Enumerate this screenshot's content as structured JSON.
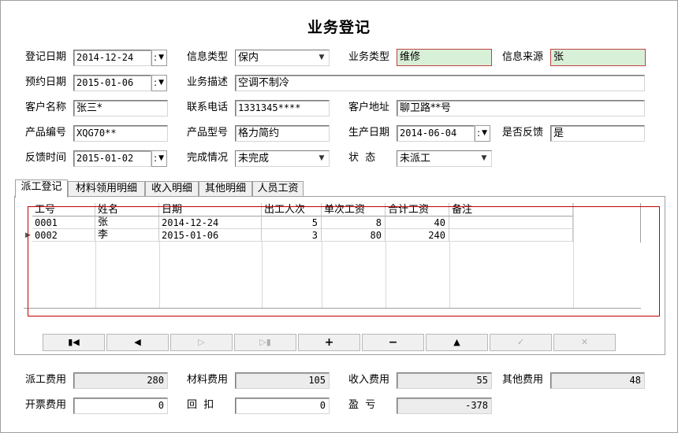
{
  "title": "业务登记",
  "form": {
    "reg_date_label": "登记日期",
    "reg_date": "2014-12-24",
    "info_type_label": "信息类型",
    "info_type": "保内",
    "biz_type_label": "业务类型",
    "biz_type": "维修",
    "info_source_label": "信息来源",
    "info_source": "张",
    "appt_date_label": "预约日期",
    "appt_date": "2015-01-06",
    "biz_desc_label": "业务描述",
    "biz_desc": "空调不制冷",
    "customer_label": "客户名称",
    "customer": "张三*",
    "phone_label": "联系电话",
    "phone": "1331345****",
    "address_label": "客户地址",
    "address": "聊卫路**号",
    "product_no_label": "产品编号",
    "product_no": "XQG70**",
    "product_model_label": "产品型号",
    "product_model": "格力简约",
    "prod_date_label": "生产日期",
    "prod_date": "2014-06-04",
    "feedback_label": "是否反馈",
    "feedback": "是",
    "feedback_time_label": "反馈时间",
    "feedback_time": "2015-01-02",
    "completion_label": "完成情况",
    "completion": "未完成",
    "status_label": "状  态",
    "status": "未派工"
  },
  "tabs": [
    "派工登记",
    "材料领用明细",
    "收入明细",
    "其他明细",
    "人员工资"
  ],
  "grid": {
    "columns": [
      "工号",
      "姓名",
      "日期",
      "出工人次",
      "单次工资",
      "合计工资",
      "备注"
    ],
    "rows": [
      [
        "0001",
        "张",
        "2014-12-24",
        "5",
        "8",
        "40",
        ""
      ],
      [
        "0002",
        "李",
        "2015-01-06",
        "3",
        "80",
        "240",
        ""
      ]
    ]
  },
  "nav": {
    "first": "first-record",
    "prev": "prev-record",
    "next": "next-record",
    "last": "last-record",
    "add": "add",
    "delete": "delete",
    "edit": "edit",
    "post": "post",
    "cancel": "cancel"
  },
  "summary": {
    "dispatch_fee_label": "派工费用",
    "dispatch_fee": "280",
    "material_fee_label": "材料费用",
    "material_fee": "105",
    "income_fee_label": "收入费用",
    "income_fee": "55",
    "other_fee_label": "其他费用",
    "other_fee": "48",
    "invoice_fee_label": "开票费用",
    "invoice_fee": "0",
    "deduct_label": "回  扣",
    "deduct": "0",
    "profit_label": "盈  亏",
    "profit": "-378"
  },
  "colors": {
    "highlight_field": "#d8f0d8",
    "red_border": "#c00000"
  }
}
